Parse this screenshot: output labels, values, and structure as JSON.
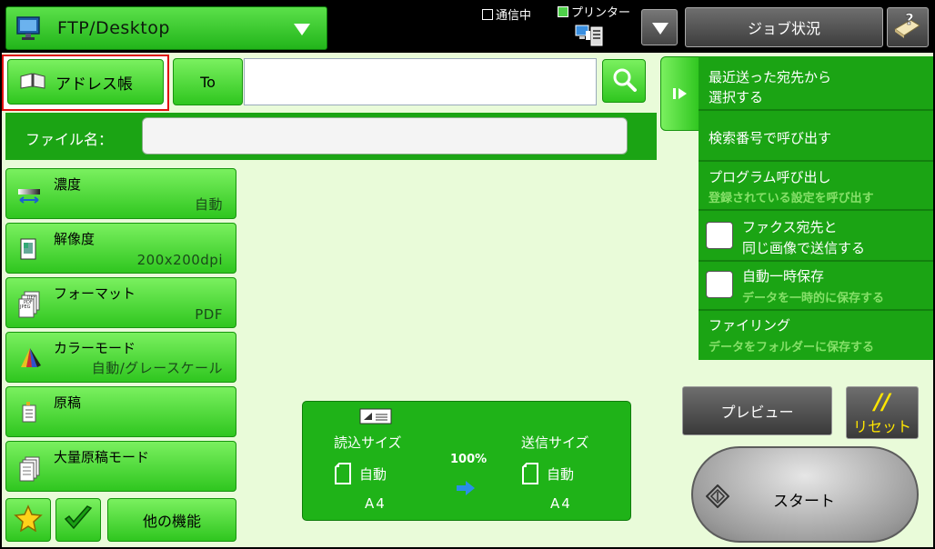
{
  "header": {
    "mode": "FTP/Desktop",
    "status_comm": "通信中",
    "status_printer": "プリンター",
    "job_status": "ジョブ状況"
  },
  "address": {
    "book_label": "アドレス帳",
    "to_label": "To",
    "to_value": ""
  },
  "filename": {
    "label": "ファイル名：",
    "value": ""
  },
  "settings": [
    {
      "name": "濃度",
      "value": "自動",
      "icon": "density-icon"
    },
    {
      "name": "解像度",
      "value": "200x200dpi",
      "icon": "resolution-icon"
    },
    {
      "name": "フォーマット",
      "value": "PDF",
      "icon": "format-icon",
      "icon_text": [
        "TIFF",
        "PDF",
        "JPEG"
      ]
    },
    {
      "name": "カラーモード",
      "value": "自動/グレースケール",
      "icon": "color-mode-icon"
    },
    {
      "name": "原稿",
      "value": "",
      "icon": "original-icon"
    },
    {
      "name": "大量原稿モード",
      "value": "",
      "icon": "job-build-icon"
    }
  ],
  "bottom_left": {
    "other_functions": "他の機能"
  },
  "size_panel": {
    "scan_label": "読込サイズ",
    "scan_mode": "自動",
    "scan_size": "A4",
    "ratio": "100%",
    "send_label": "送信サイズ",
    "send_mode": "自動",
    "send_size": "A4"
  },
  "sidebar": {
    "items": [
      {
        "line1": "最近送った宛先から",
        "line2": "選択する"
      },
      {
        "line1": "検索番号で呼び出す"
      },
      {
        "line1": "プログラム呼び出し",
        "sub": "登録されている設定を呼び出す"
      },
      {
        "line1": "ファクス宛先と",
        "line2": "同じ画像で送信する"
      },
      {
        "line1": "自動一時保存",
        "sub": "データを一時的に保存する"
      },
      {
        "line1": "ファイリング",
        "sub": "データをフォルダーに保存する"
      }
    ]
  },
  "actions": {
    "preview": "プレビュー",
    "reset_symbol": "//",
    "reset": "リセット",
    "start": "スタート"
  },
  "colors": {
    "accent_green": "#1ba414",
    "button_green": "#2fc61f",
    "panel_bg": "#e9fbd9",
    "highlight_red": "#e01010",
    "reset_yellow": "#ffe600"
  }
}
